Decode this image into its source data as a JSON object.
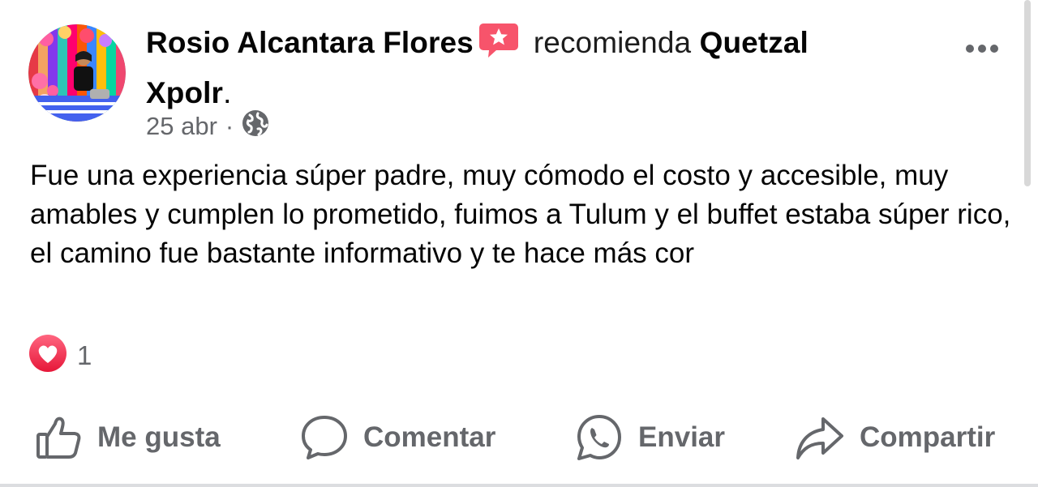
{
  "header": {
    "author": "Rosio Alcantara Flores",
    "verb": "recomienda",
    "page": "Quetzal Xpolr",
    "period": ".",
    "date": "25 abr",
    "separator": "·",
    "audience_icon": "globe-icon",
    "recommend_icon": "recommend-star-icon"
  },
  "post": {
    "text": "Fue una experiencia súper padre, muy cómodo el costo y accesible, muy amables y cumplen lo prometido, fuimos a Tulum y el buffet estaba súper rico, el camino fue bastante informativo y te hace más cor"
  },
  "reactions": {
    "icon": "love-reaction-icon",
    "count": "1"
  },
  "actions": {
    "like": "Me gusta",
    "comment": "Comentar",
    "send": "Enviar",
    "share": "Compartir"
  },
  "colors": {
    "secondary_text": "#65676b",
    "love_red": "#f33e58",
    "recommend_red": "#f7546b"
  }
}
